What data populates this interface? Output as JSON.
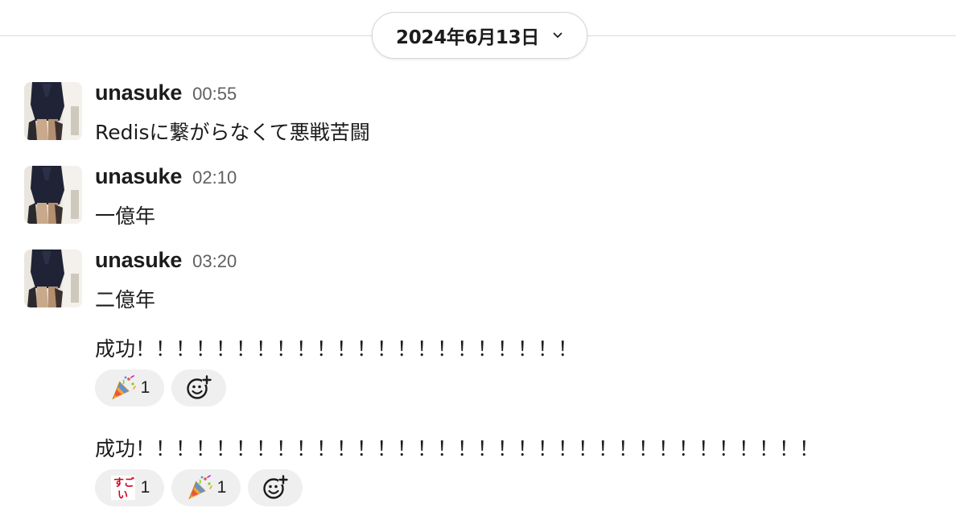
{
  "date_divider": {
    "label": "2024年6月13日",
    "icon": "chevron-down-icon"
  },
  "messages": [
    {
      "sender": "unasuke",
      "time": "00:55",
      "text": "Redisに繋がらなくて悪戦苦闘"
    },
    {
      "sender": "unasuke",
      "time": "02:10",
      "text": "一億年"
    },
    {
      "sender": "unasuke",
      "time": "03:20",
      "text": "二億年"
    }
  ],
  "followups": [
    {
      "text": "成功！！！！！！！！！！！！！！！！！！！！！！",
      "reactions": [
        {
          "emoji": "party-popper-icon",
          "count": "1"
        }
      ]
    },
    {
      "text": "成功！！！！！！！！！！！！！！！！！！！！！！！！！！！！！！！！！！",
      "reactions": [
        {
          "emoji": "sugoi-icon",
          "count": "1",
          "emoji_text": "すごい"
        },
        {
          "emoji": "party-popper-icon",
          "count": "1"
        }
      ]
    }
  ],
  "add_reaction_icon": "add-reaction-icon",
  "colors": {
    "text": "#1d1c1d",
    "muted": "#616061",
    "reaction_bg": "#efefef",
    "divider": "#dddddd",
    "sugoi_red": "#d0021b"
  }
}
